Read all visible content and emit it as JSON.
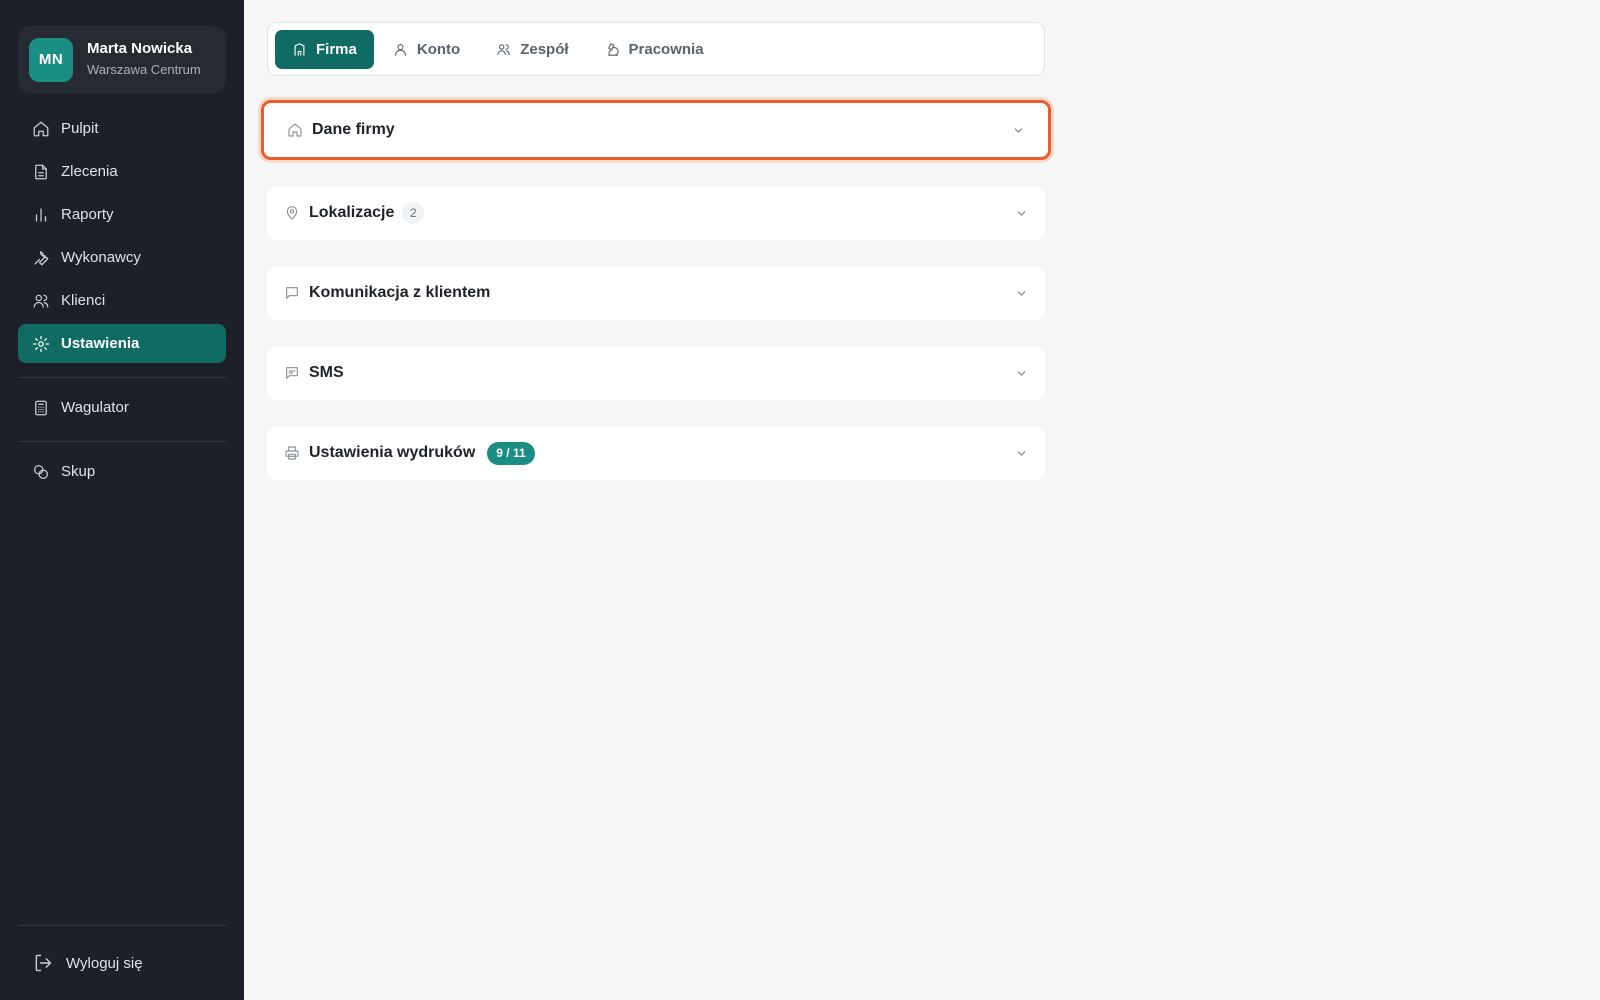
{
  "user": {
    "initials": "MN",
    "name": "Marta Nowicka",
    "location": "Warszawa Centrum"
  },
  "sidebar": {
    "items": [
      {
        "label": "Pulpit",
        "icon": "home-icon"
      },
      {
        "label": "Zlecenia",
        "icon": "document-icon"
      },
      {
        "label": "Raporty",
        "icon": "bar-chart-icon"
      },
      {
        "label": "Wykonawcy",
        "icon": "wrench-icon"
      },
      {
        "label": "Klienci",
        "icon": "users-icon"
      },
      {
        "label": "Ustawienia",
        "icon": "gear-icon",
        "active": true
      }
    ],
    "tools": [
      {
        "label": "Wagulator",
        "icon": "calculator-icon"
      },
      {
        "label": "Skup",
        "icon": "coins-icon"
      }
    ],
    "logout_label": "Wyloguj się"
  },
  "tabs": [
    {
      "label": "Firma",
      "icon": "building-icon",
      "active": true
    },
    {
      "label": "Konto",
      "icon": "user-icon"
    },
    {
      "label": "Zespół",
      "icon": "users-icon"
    },
    {
      "label": "Pracownia",
      "icon": "microscope-icon"
    }
  ],
  "sections": [
    {
      "title": "Dane firmy",
      "icon": "home-icon",
      "focused": true
    },
    {
      "title": "Lokalizacje",
      "icon": "map-pin-icon",
      "count": "2"
    },
    {
      "title": "Komunikacja z klientem",
      "icon": "chat-icon"
    },
    {
      "title": "SMS",
      "icon": "message-square-icon"
    },
    {
      "title": "Ustawienia wydruków",
      "icon": "printer-icon",
      "badge": "9 / 11"
    }
  ],
  "colors": {
    "sidebar_bg": "#1d2029",
    "accent": "#116b65",
    "badge": "#1a8d84",
    "focus_ring": "#ee5b2b"
  }
}
